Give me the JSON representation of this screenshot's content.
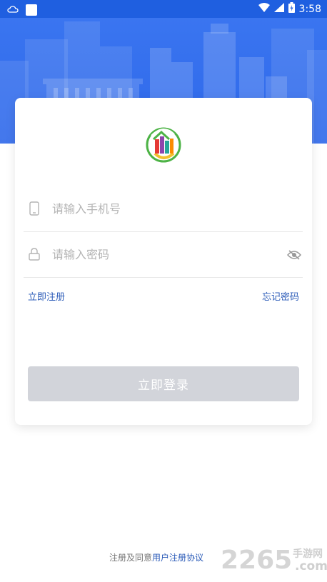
{
  "status_bar": {
    "time": "3:58"
  },
  "login": {
    "phone_placeholder": "请输入手机号",
    "password_placeholder": "请输入密码",
    "register_link": "立即注册",
    "forgot_link": "忘记密码",
    "login_button": "立即登录"
  },
  "agreement": {
    "prefix": "注册及同意",
    "link": "用户注册协议"
  },
  "watermark": {
    "number": "2265",
    "site_top": "手游网",
    "site_bottom": ".com"
  },
  "colors": {
    "primary": "#2e68ea",
    "link": "#2b5bb8",
    "button_disabled": "#d2d4da"
  }
}
